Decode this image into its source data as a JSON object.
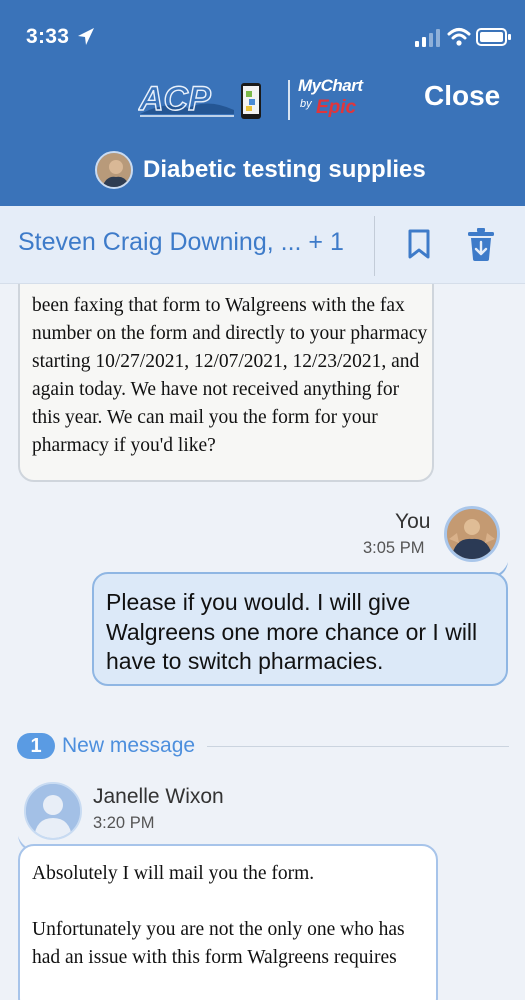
{
  "status_bar": {
    "time": "3:33"
  },
  "header": {
    "close_label": "Close",
    "conversation_title": "Diabetic testing supplies",
    "logo": {
      "acp": "ACP",
      "mychart": "MyChart",
      "by": "by",
      "epic": "Epic"
    }
  },
  "recipients": {
    "text": "Steven Craig Downing, ... + 1"
  },
  "messages": [
    {
      "direction": "incoming",
      "text": "been faxing that form to Walgreens with the fax number on the form and directly to your pharmacy starting 10/27/2021, 12/07/2021, 12/23/2021, and again today. We have not received anything for this year. We can mail you the form for your pharmacy if you'd like?"
    },
    {
      "direction": "outgoing",
      "sender": "You",
      "time": "3:05 PM",
      "text": "Please if you would.  I will give Walgreens one more chance or I will have to switch pharmacies."
    },
    {
      "direction": "incoming",
      "sender": "Janelle Wixon",
      "time": "3:20 PM",
      "text": "Absolutely I will mail you the form.\n\nUnfortunately you are not the only one who has had an issue with this form Walgreens requires"
    }
  ],
  "new_message_divider": {
    "count": "1",
    "label": "New message"
  },
  "colors": {
    "header_bg": "#3a73b9",
    "accent_blue": "#3e7bc9",
    "epic_red": "#e0353b",
    "outgoing_bubble": "#dce9f8"
  },
  "icons": [
    "location-arrow-icon",
    "signal-icon",
    "wifi-icon",
    "battery-icon",
    "bookmark-icon",
    "trash-icon"
  ]
}
